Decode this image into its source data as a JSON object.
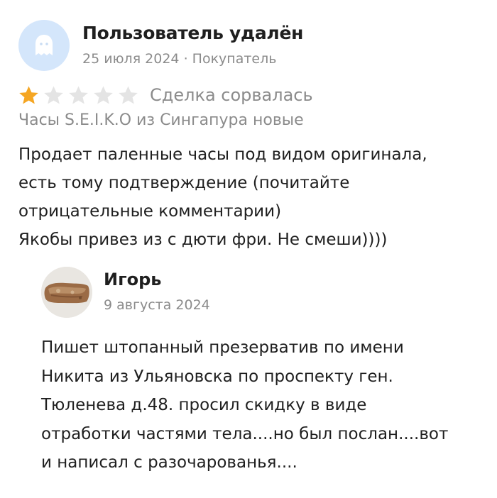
{
  "review": {
    "author": "Пользователь удалён",
    "date": "25 июля 2024",
    "separator": " · ",
    "role": "Покупатель",
    "rating": 1,
    "rating_max": 5,
    "star_filled_color": "#f5a623",
    "star_empty_color": "#e4e4e4",
    "deal_status": "Сделка сорвалась",
    "product": "Часы S.E.I.K.O из Сингапура новые",
    "text_lines": [
      "Продает паленные часы под видом оригинала,",
      "есть тому подтверждение (почитайте",
      "отрицательные комментарии)",
      "Якобы привез из с дюти фри. Не смеши))))"
    ],
    "avatar_icon": "ghost-icon"
  },
  "reply": {
    "author": "Игорь",
    "date": "9 августа 2024",
    "text_lines": [
      "Пишет штопанный презерватив по имени",
      "Никита из Ульяновска по проспекту ген.",
      "Тюленева д.48. просил скидку в виде",
      "отработки частями тела....но был послан....вот",
      "и написал с разочарованья...."
    ]
  }
}
